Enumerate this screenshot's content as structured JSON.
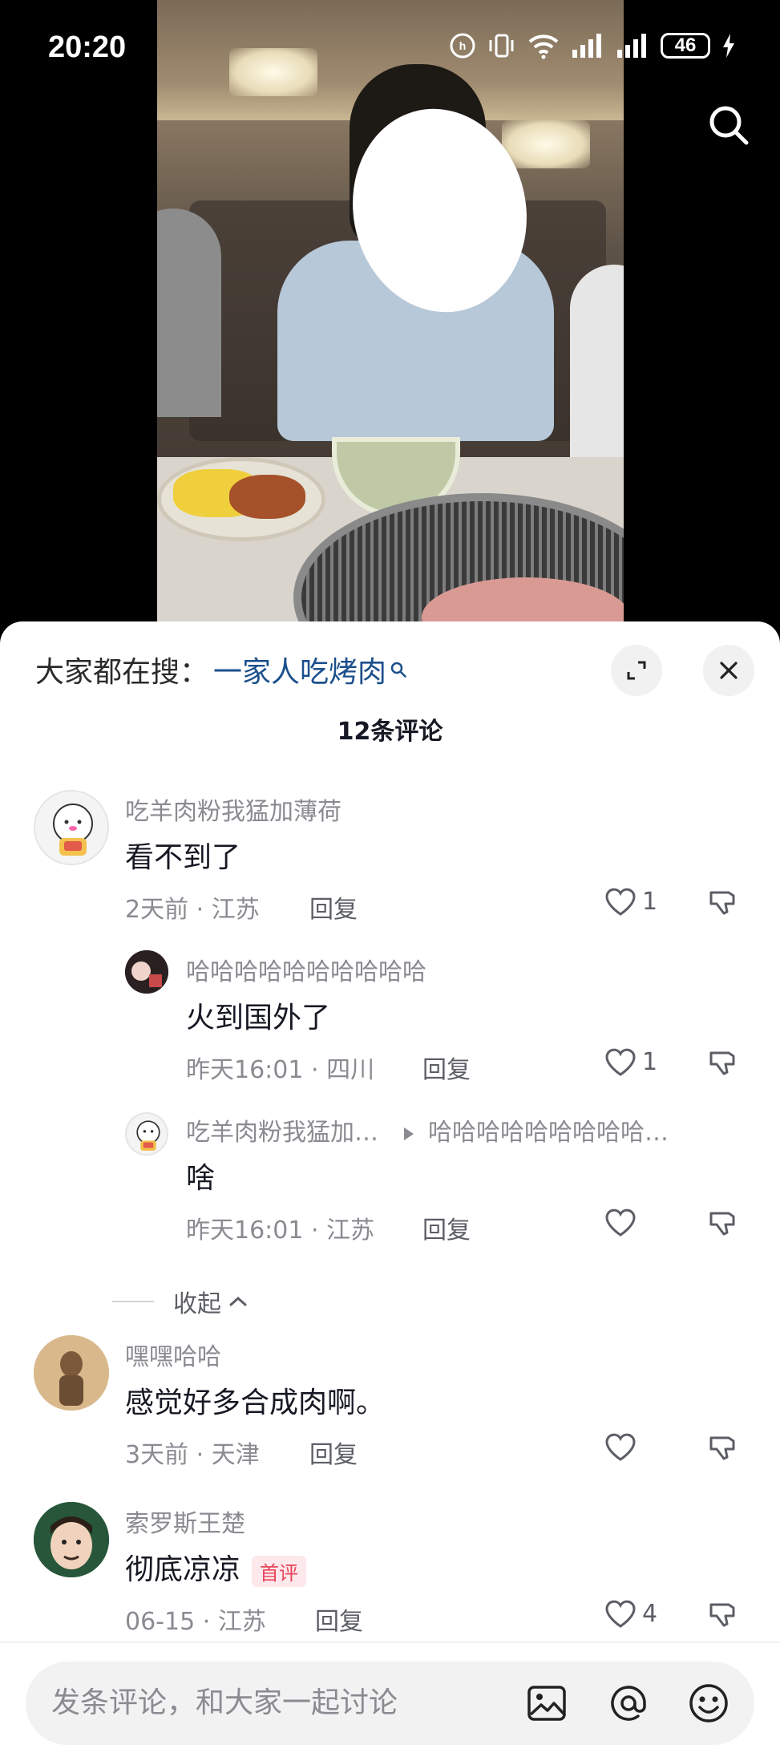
{
  "status_bar": {
    "time": "20:20",
    "battery": "46"
  },
  "sheet": {
    "search_prefix": "大家都在搜：",
    "search_term": "一家人吃烤肉",
    "comment_count": "12条评论",
    "collapse_label": "收起"
  },
  "comments": [
    {
      "user": "吃羊肉粉我猛加薄荷",
      "text": "看不到了",
      "time": "2天前",
      "location": "江苏",
      "reply_label": "回复",
      "likes": "1"
    },
    {
      "user": "哈哈哈哈哈哈哈哈哈哈",
      "text": "火到国外了",
      "time": "昨天16:01",
      "location": "四川",
      "reply_label": "回复",
      "likes": "1"
    },
    {
      "user": "吃羊肉粉我猛加…",
      "reply_to": "哈哈哈哈哈哈哈哈哈…",
      "text": "啥",
      "time": "昨天16:01",
      "location": "江苏",
      "reply_label": "回复",
      "likes": ""
    },
    {
      "user": "嘿嘿哈哈",
      "text": "感觉好多合成肉啊。",
      "time": "3天前",
      "location": "天津",
      "reply_label": "回复",
      "likes": ""
    },
    {
      "user": "索罗斯王楚",
      "text": "彻底凉凉",
      "badge": "首评",
      "time": "06-15",
      "location": "江苏",
      "reply_label": "回复",
      "likes": "4"
    }
  ],
  "meta_separator": "·",
  "input": {
    "placeholder": "发条评论，和大家一起讨论"
  },
  "icons": {
    "top_search": "search-icon",
    "expand": "expand-icon",
    "close": "close-icon",
    "like": "heart-icon",
    "dislike": "thumb-down-icon",
    "image": "image-icon",
    "mention": "at-icon",
    "emoji": "emoji-icon"
  },
  "colors": {
    "search_term": "#1b4f8c",
    "badge": "#e8445a"
  }
}
